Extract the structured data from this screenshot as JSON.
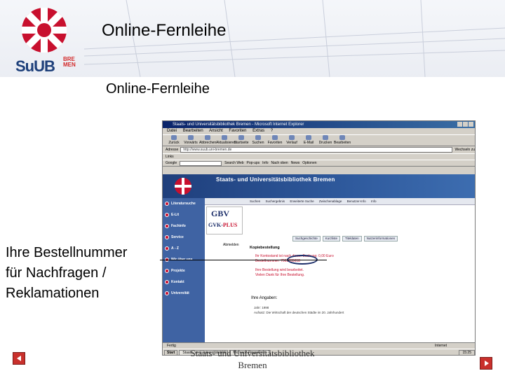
{
  "slide": {
    "title": "Online-Fernleihe",
    "subtitle": "Online-Fernleihe",
    "note_line1": "Ihre Bestellnummer",
    "note_line2": "für Nachfragen /",
    "note_line3": "Reklamationen",
    "footer_line1": "Staats- und Universitätsbibliothek",
    "footer_line2": "Bremen"
  },
  "logo": {
    "text": "SuUB",
    "bre": "BRE",
    "men": "MEN"
  },
  "browser": {
    "window_title": "Staats- und Universitätsbibliothek Bremen - Microsoft Internet Explorer",
    "menu": [
      "Datei",
      "Bearbeiten",
      "Ansicht",
      "Favoriten",
      "Extras",
      "?"
    ],
    "toolbar": [
      "Zurück",
      "Vorwärts",
      "Abbrechen",
      "Aktualisieren",
      "Startseite",
      "Suchen",
      "Favoriten",
      "Verlauf",
      "E-Mail",
      "Drucken",
      "Bearbeiten"
    ],
    "address_label": "Adresse",
    "address_value": "http://www.suub.uni-bremen.de",
    "go_label": "Wechseln zu",
    "links_label": "Links",
    "google_label": "Google",
    "google_items": [
      "Search Web",
      "Pop-ups",
      "Info",
      "Nach oben",
      "News",
      "Optionen"
    ],
    "site": {
      "banner_name": "Staats- und Universitätsbibliothek Bremen",
      "nav": [
        "Literatursuche",
        "E-Lit",
        "Fachinfo",
        "Service",
        "A - Z",
        "Wir über uns",
        "Projekte",
        "Kontakt",
        "Universität"
      ],
      "top_links": [
        "Suchen",
        "Suchergebnis",
        "Erweiterte Suche",
        "Zwischenablage",
        "Benutzer-Info",
        "Info"
      ],
      "gbv_line1": "GBV",
      "gbv_line2a": "GVK-",
      "gbv_line2b": "PLUS",
      "abmelden": "Abmelden",
      "tabs": [
        "Suchgeschichte",
        "Kurzliste",
        "Titeldaten",
        "Nutzerinformationen"
      ],
      "order_heading": "Kopiebestellung",
      "msg1": "Ihr Kontostand ist nach dieser Buchung: 0,00 Euro",
      "msg2": "Bestellnummer: 7062205618",
      "msg3": "Ihre Bestellung wird bearbeitet.",
      "msg4": "Vielen Dank für Ihre Bestellung.",
      "angaben_heading": "Ihre Angaben:",
      "angaben_row1": "Jahr:       1998",
      "angaben_row2": "Aufsatz:   Die Wirtschaft der deutschen Städte im 20. Jahrhundert"
    },
    "statusbar": "Fertig",
    "status_zone": "Internet",
    "taskbar": {
      "start": "Start",
      "tasks": [
        "Staats- und Universitätsbibliothek",
        "Microsoft PowerPoint"
      ],
      "clock": "15:25"
    }
  },
  "colors": {
    "brand_red": "#c8102e",
    "brand_blue": "#1d3f7a",
    "nav_blue": "#3f63a3",
    "highlight": "#1d2f6a"
  }
}
